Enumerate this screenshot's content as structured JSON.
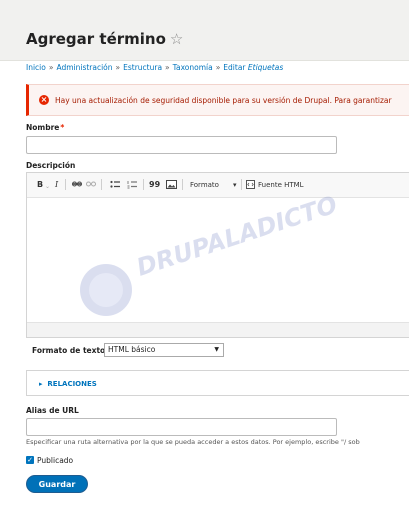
{
  "header": {
    "title": "Agregar término"
  },
  "breadcrumb": {
    "items": [
      "Inicio",
      "Administración",
      "Estructura",
      "Taxonomía",
      "Editar"
    ],
    "current": "Etiquetas",
    "separator": "»"
  },
  "alert": {
    "text": "Hay una actualización de seguridad disponible para su versión de Drupal. Para garantizar"
  },
  "form": {
    "name_label": "Nombre",
    "required_mark": "*",
    "description_label": "Descripción",
    "toolbar": {
      "bold": "B",
      "italic": "I",
      "quote": "99",
      "format_label": "Formato",
      "source_label": "Fuente HTML"
    },
    "text_format_label": "Formato de texto",
    "text_format_value": "HTML básico",
    "relations_label": "RELACIONES",
    "url_alias_label": "Alias de URL",
    "url_alias_help": "Especificar una ruta alternativa por la que se pueda acceder a estos datos. Por ejemplo, escribe \"/ sob",
    "published_label": "Publicado",
    "save_label": "Guardar"
  },
  "watermark": {
    "text": "DRUPALADICTO"
  },
  "colors": {
    "link": "#0074bd",
    "error": "#e62600",
    "primary_button": "#0071b8"
  }
}
